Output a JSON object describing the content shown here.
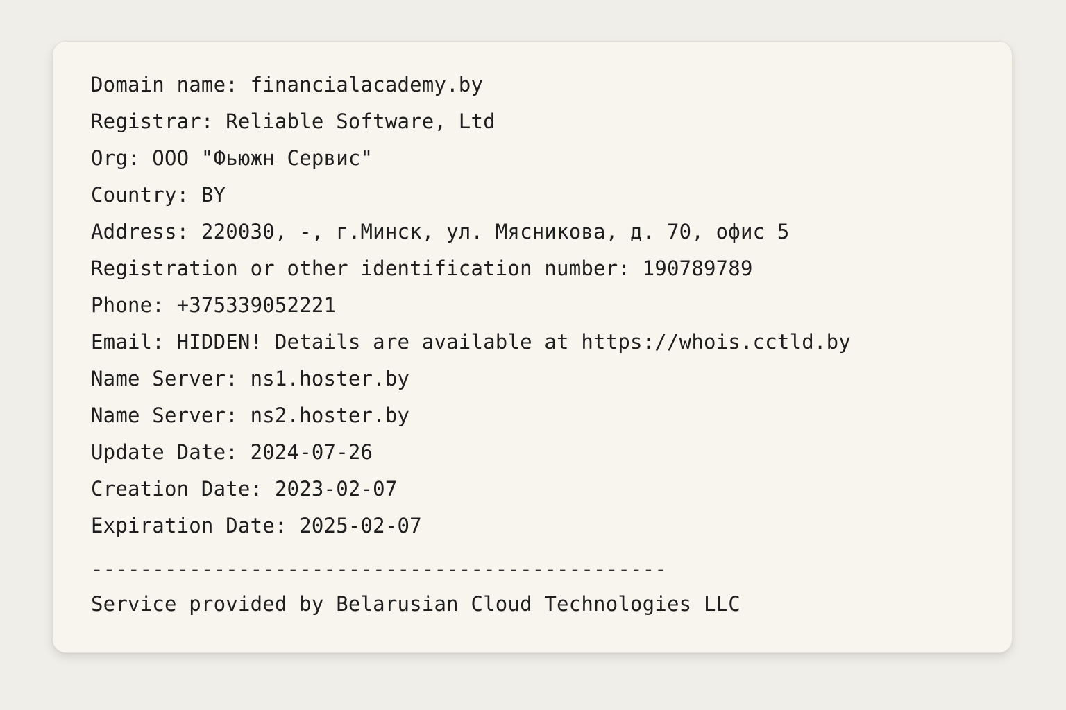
{
  "whois": {
    "lines": [
      "Domain name: financialacademy.by",
      "Registrar: Reliable Software, Ltd",
      "Org: ООО \"Фьюжн Сервис\"",
      "Country: BY",
      "Address: 220030, -, г.Минск, ул. Мясникова, д. 70, офис 5",
      "Registration or other identification number: 190789789",
      "Phone: +375339052221",
      "Email: HIDDEN! Details are available at https://whois.cctld.by",
      "Name Server: ns1.hoster.by",
      "Name Server: ns2.hoster.by",
      "Update Date: 2024-07-26",
      "Creation Date: 2023-02-07",
      "Expiration Date: 2025-02-07"
    ],
    "separator": "-----------------------------------------------",
    "footer": "Service provided by Belarusian Cloud Technologies LLC"
  },
  "colors": {
    "page_background": "#f0eee9",
    "card_background": "#f8f5ef",
    "text": "#1e1e1e"
  }
}
